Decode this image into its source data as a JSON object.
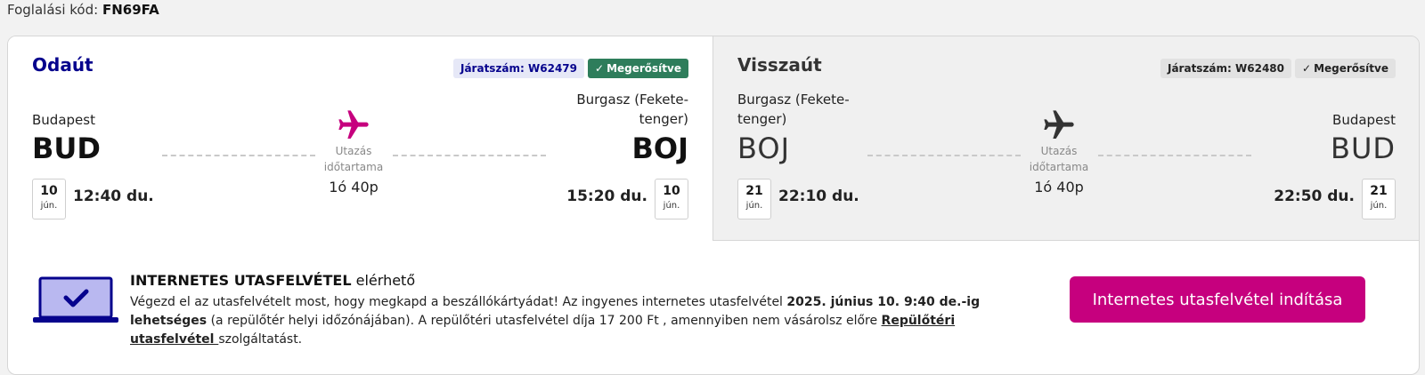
{
  "booking": {
    "label": "Foglalási kód:",
    "code": "FN69FA"
  },
  "outbound": {
    "title": "Odaút",
    "flight_label": "Járatszám: W62479",
    "status": "Megerősítve",
    "origin_city": "Budapest",
    "origin_code": "BUD",
    "dest_city": "Burgasz (Fekete-tenger)",
    "dest_city_line1": "Burgasz (Fekete-",
    "dest_city_line2": "tenger)",
    "dest_code": "BOJ",
    "duration_label_line1": "Utazás",
    "duration_label_line2": "időtartama",
    "duration": "1ó 40p",
    "dep_day": "10",
    "dep_month": "jún.",
    "dep_time": "12:40 du.",
    "arr_day": "10",
    "arr_month": "jún.",
    "arr_time": "15:20 du.",
    "accent_color": "#c6007e"
  },
  "return": {
    "title": "Visszaút",
    "flight_label": "Járatszám: W62480",
    "status": "Megerősítve",
    "origin_city_line1": "Burgasz (Fekete-",
    "origin_city_line2": "tenger)",
    "origin_code": "BOJ",
    "dest_city": "Budapest",
    "dest_code": "BUD",
    "duration_label_line1": "Utazás",
    "duration_label_line2": "időtartama",
    "duration": "1ó 40p",
    "dep_day": "21",
    "dep_month": "jún.",
    "dep_time": "22:10 du.",
    "arr_day": "21",
    "arr_month": "jún.",
    "arr_time": "22:50 du."
  },
  "checkin": {
    "title_main": "INTERNETES UTASFELVÉTEL",
    "title_rest": " elérhető",
    "text_1": "Végezd el az utasfelvételt most, hogy megkapd a beszállókártyádat! Az ingyenes internetes utasfelvétel ",
    "text_bold": "2025. június 10. 9:40 de.-ig lehetséges",
    "text_2": " (a repülőtér helyi időzónájában). A repülőtéri utasfelvétel díja 17 200 Ft , amennyiben nem vásárolsz előre ",
    "text_link": "Repülőtéri utasfelvétel ",
    "text_3": "szolgáltatást.",
    "button": "Internetes utasfelvétel indítása",
    "button_color": "#c6007e"
  }
}
